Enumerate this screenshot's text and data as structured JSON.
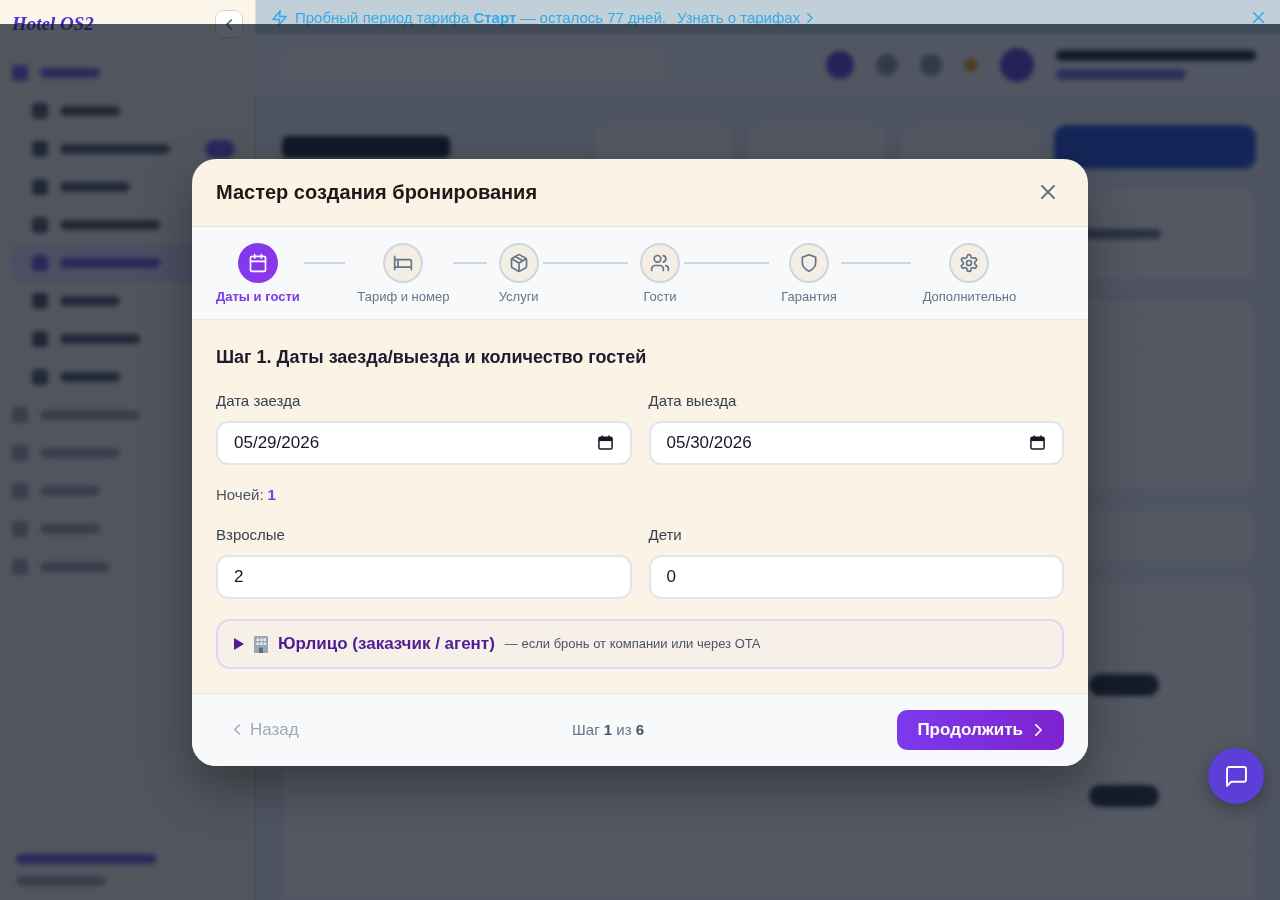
{
  "sidebar": {
    "logo": "Hotel OS2"
  },
  "banner": {
    "message": "Пробный период тарифа **Старт** — осталось 77 дней.",
    "link": "Узнать о тарифах"
  },
  "dialog": {
    "title": "Мастер создания бронирования",
    "steps": [
      {
        "label": "Даты и гости",
        "selected": true
      },
      {
        "label": "Тариф и номер",
        "selected": false
      },
      {
        "label": "Услуги",
        "selected": false
      },
      {
        "label": "Гости",
        "selected": false
      },
      {
        "label": "Гарантия",
        "selected": false
      },
      {
        "label": "Дополнительно",
        "selected": false
      }
    ],
    "step_heading": "Шаг 1. Даты заезда/выезда и количество гостей",
    "dates": [
      {
        "label": "Дата заезда",
        "value": "05/29/2026"
      },
      {
        "label": "Дата выезда",
        "value": "05/30/2026"
      }
    ],
    "nights": {
      "label": "Ночей:",
      "value": "1"
    },
    "guests": [
      {
        "label": "Взрослые",
        "value": "2"
      },
      {
        "label": "Дети",
        "value": "0"
      }
    ],
    "legal_entity": {
      "title": "Юрлицо (заказчик / агент)",
      "hint": "— если бронь от компании или через OTA",
      "expanded": false
    },
    "footer": {
      "back": {
        "label": "Назад",
        "disabled": true
      },
      "progress": "Шаг **1** из **6**",
      "next": "Продолжить"
    }
  }
}
